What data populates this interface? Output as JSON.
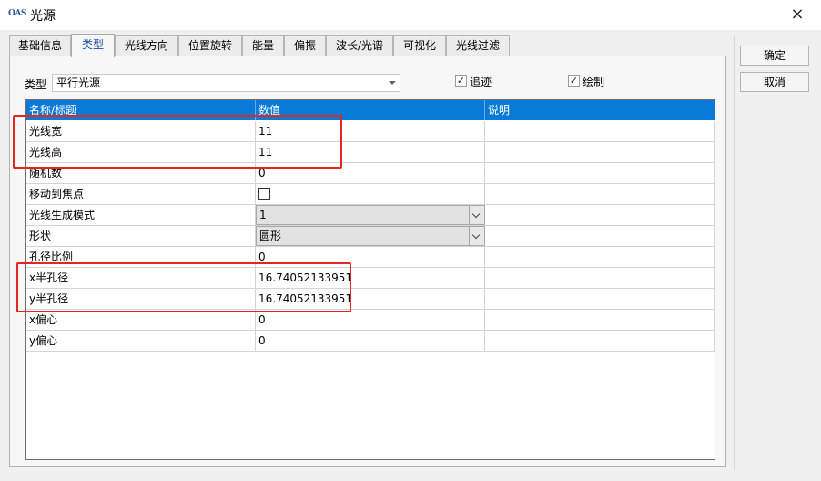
{
  "window": {
    "title": "光源",
    "icon_text": "OAS",
    "close_symbol": "×"
  },
  "tabs": [
    {
      "label": "基础信息",
      "active": false
    },
    {
      "label": "类型",
      "active": true
    },
    {
      "label": "光线方向",
      "active": false
    },
    {
      "label": "位置旋转",
      "active": false
    },
    {
      "label": "能量",
      "active": false
    },
    {
      "label": "偏振",
      "active": false
    },
    {
      "label": "波长/光谱",
      "active": false
    },
    {
      "label": "可视化",
      "active": false
    },
    {
      "label": "光线过滤",
      "active": false
    }
  ],
  "type_field": {
    "label": "类型",
    "value": "平行光源"
  },
  "checkboxes": {
    "trace": {
      "label": "追迹",
      "checked": true
    },
    "draw": {
      "label": "绘制",
      "checked": true
    }
  },
  "grid": {
    "headers": [
      "名称/标题",
      "数值",
      "说明"
    ],
    "rows": [
      {
        "name": "光线宽",
        "value": "11",
        "desc": ""
      },
      {
        "name": "光线高",
        "value": "11",
        "desc": ""
      },
      {
        "name": "随机数",
        "value": "0",
        "desc": ""
      },
      {
        "name": "移动到焦点",
        "value": "",
        "desc": "",
        "kind": "checkbox",
        "checked": false
      },
      {
        "name": "光线生成模式",
        "value": "1",
        "desc": "",
        "kind": "combo"
      },
      {
        "name": "形状",
        "value": "圆形",
        "desc": "",
        "kind": "combo"
      },
      {
        "name": "孔径比例",
        "value": "0",
        "desc": ""
      },
      {
        "name": "x半孔径",
        "value": "16.74052133951",
        "desc": ""
      },
      {
        "name": "y半孔径",
        "value": "16.74052133951",
        "desc": ""
      },
      {
        "name": "x偏心",
        "value": "0",
        "desc": ""
      },
      {
        "name": "y偏心",
        "value": "0",
        "desc": ""
      }
    ]
  },
  "buttons": {
    "ok": "确定",
    "cancel": "取消"
  },
  "colors": {
    "header_bg": "#0a7ad8",
    "highlight": "#e0281e",
    "active_tab_text": "#1a4fa0"
  }
}
